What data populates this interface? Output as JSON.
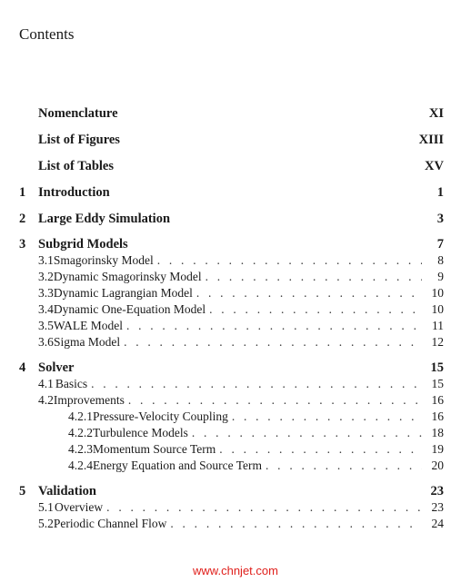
{
  "heading": "Contents",
  "entries": [
    {
      "level": "chapter",
      "number": "",
      "title": "Nomenclature",
      "page": "XI"
    },
    {
      "level": "chapter",
      "number": "",
      "title": "List of Figures",
      "page": "XIII"
    },
    {
      "level": "chapter",
      "number": "",
      "title": "List of Tables",
      "page": "XV"
    },
    {
      "level": "chapter",
      "number": "1",
      "title": "Introduction",
      "page": "1"
    },
    {
      "level": "chapter",
      "number": "2",
      "title": "Large Eddy Simulation",
      "page": "3"
    },
    {
      "level": "chapter",
      "number": "3",
      "title": "Subgrid Models",
      "page": "7"
    },
    {
      "level": "section",
      "number": "3.1",
      "title": "Smagorinsky Model",
      "page": "8"
    },
    {
      "level": "section",
      "number": "3.2",
      "title": "Dynamic Smagorinsky Model",
      "page": "9"
    },
    {
      "level": "section",
      "number": "3.3",
      "title": "Dynamic Lagrangian Model",
      "page": "10"
    },
    {
      "level": "section",
      "number": "3.4",
      "title": "Dynamic One-Equation Model",
      "page": "10"
    },
    {
      "level": "section",
      "number": "3.5",
      "title": "WALE Model",
      "page": "11"
    },
    {
      "level": "section",
      "number": "3.6",
      "title": "Sigma Model",
      "page": "12"
    },
    {
      "level": "chapter",
      "number": "4",
      "title": "Solver",
      "page": "15"
    },
    {
      "level": "section",
      "number": "4.1",
      "title": "Basics",
      "page": "15"
    },
    {
      "level": "section",
      "number": "4.2",
      "title": "Improvements",
      "page": "16"
    },
    {
      "level": "subsection",
      "number": "4.2.1",
      "title": "Pressure-Velocity Coupling",
      "page": "16"
    },
    {
      "level": "subsection",
      "number": "4.2.2",
      "title": "Turbulence Models",
      "page": "18"
    },
    {
      "level": "subsection",
      "number": "4.2.3",
      "title": "Momentum Source Term",
      "page": "19"
    },
    {
      "level": "subsection",
      "number": "4.2.4",
      "title": "Energy Equation and Source Term",
      "page": "20"
    },
    {
      "level": "chapter",
      "number": "5",
      "title": "Validation",
      "page": "23"
    },
    {
      "level": "section",
      "number": "5.1",
      "title": "Overview",
      "page": "23"
    },
    {
      "level": "section",
      "number": "5.2",
      "title": "Periodic Channel Flow",
      "page": "24"
    }
  ],
  "watermark": "www.chnjet.com",
  "colors": {
    "text": "#1a1a1a",
    "watermark": "#e0201c"
  }
}
